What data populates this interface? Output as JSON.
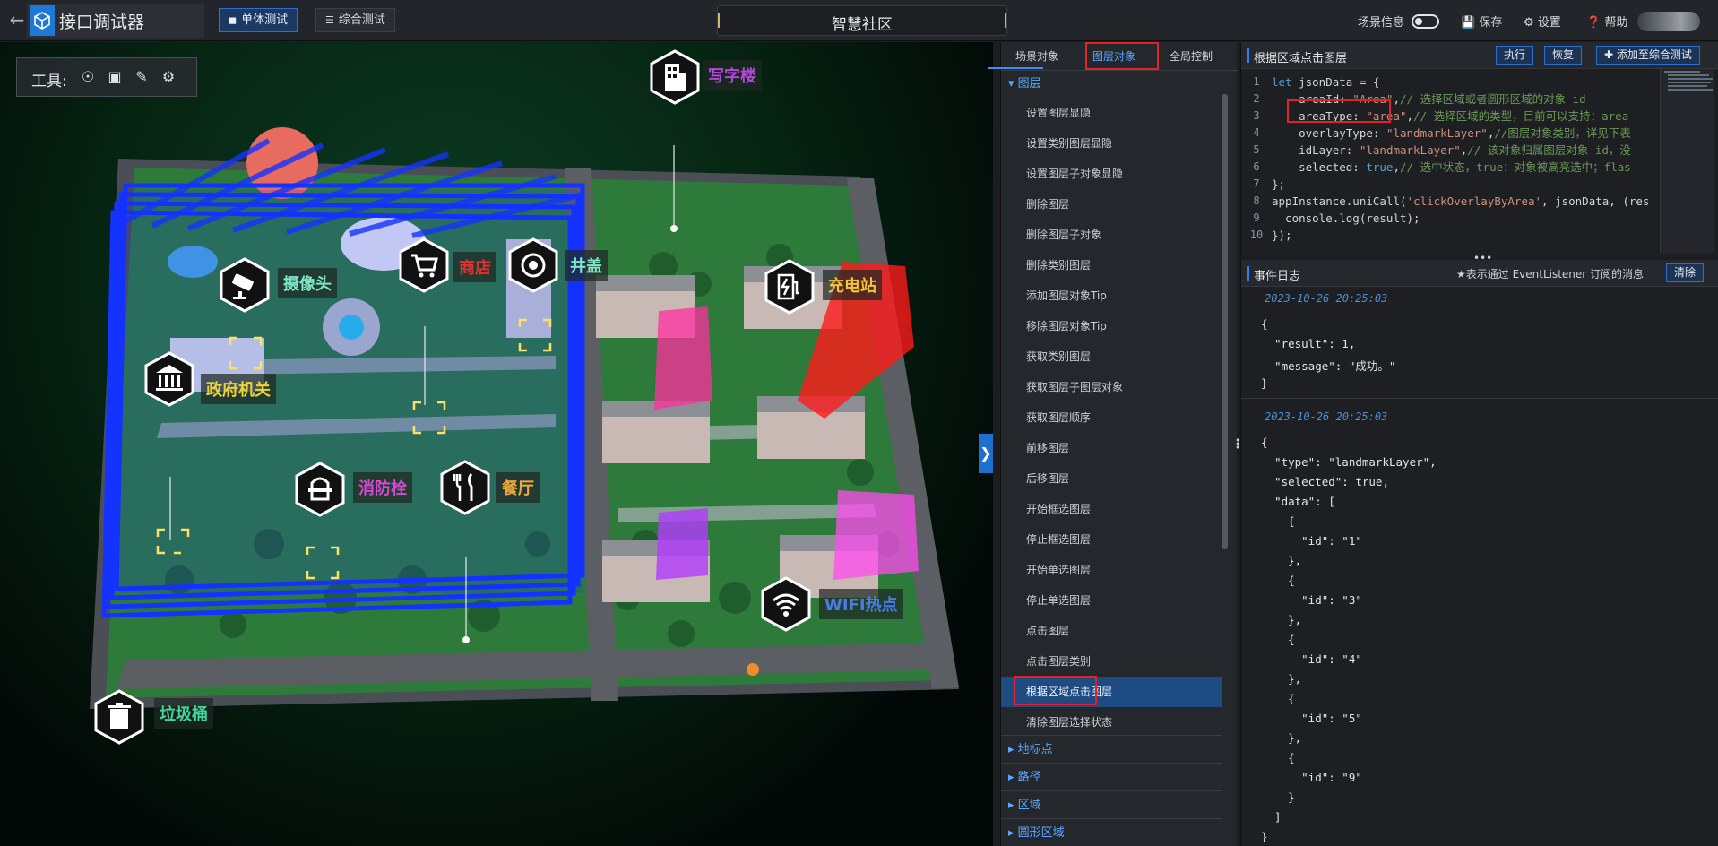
{
  "app": {
    "title": "接口调试器",
    "back_icon": "arrow-left-icon",
    "logo_icon": "cube-logo-icon"
  },
  "modes": [
    {
      "label": "单体测试",
      "active": true,
      "icon": "cube-icon"
    },
    {
      "label": "综合测试",
      "active": false,
      "icon": "layers-icon"
    }
  ],
  "scene": {
    "name": "智慧社区"
  },
  "topbar_right": {
    "scene_info_label": "场景信息",
    "scene_info_on": false,
    "save_label": "保存",
    "settings_label": "设置",
    "help_label": "帮助"
  },
  "toolbar": {
    "label": "工具:",
    "tools": [
      "locate-icon",
      "frame-select-icon",
      "pen-icon",
      "gears-icon"
    ]
  },
  "pois": [
    {
      "label": "写字楼",
      "icon": "office-building-icon",
      "color": "#b048d8"
    },
    {
      "label": "摄像头",
      "icon": "camera-icon",
      "color": "#7fe6c8"
    },
    {
      "label": "商店",
      "icon": "shopping-cart-icon",
      "color": "#e03030"
    },
    {
      "label": "井盖",
      "icon": "manhole-cover-icon",
      "color": "#7fe6c8"
    },
    {
      "label": "充电站",
      "icon": "charging-station-icon",
      "color": "#f2c436"
    },
    {
      "label": "政府机关",
      "icon": "government-icon",
      "color": "#e9d43a"
    },
    {
      "label": "消防栓",
      "icon": "fire-hydrant-icon",
      "color": "#d44ad0"
    },
    {
      "label": "餐厅",
      "icon": "restaurant-icon",
      "color": "#f2a83a"
    },
    {
      "label": "WIFI热点",
      "icon": "wifi-icon",
      "color": "#4a7be8"
    },
    {
      "label": "垃圾桶",
      "icon": "trash-bin-icon",
      "color": "#3ed6a0"
    }
  ],
  "mid_tabs": [
    {
      "label": "场景对象",
      "active": false
    },
    {
      "label": "图层对象",
      "active": true
    },
    {
      "label": "全局控制",
      "active": false
    }
  ],
  "layer_group": {
    "label": "图层",
    "expanded": true,
    "items": [
      "设置图层显隐",
      "设置类别图层显隐",
      "设置图层子对象显隐",
      "删除图层",
      "删除图层子对象",
      "删除类别图层",
      "添加图层对象Tip",
      "移除图层对象Tip",
      "获取类别图层",
      "获取图层子图层对象",
      "获取图层顺序",
      "前移图层",
      "后移图层",
      "开始框选图层",
      "停止框选图层",
      "开始单选图层",
      "停止单选图层",
      "点击图层",
      "点击图层类别",
      "根据区域点击图层",
      "清除图层选择状态"
    ],
    "selected": "根据区域点击图层"
  },
  "other_groups": [
    "地标点",
    "路径",
    "区域",
    "圆形区域"
  ],
  "code_panel": {
    "title": "根据区域点击图层",
    "buttons": {
      "run": "执行",
      "restore": "恢复",
      "add": "添加至综合测试"
    },
    "lines": [
      [
        {
          "t": "let ",
          "c": "#569cd6"
        },
        {
          "t": "jsonData = {",
          "c": "#d4d4d4"
        }
      ],
      [
        {
          "t": "    areaId: ",
          "c": "#d4d4d4"
        },
        {
          "t": "\"Area\"",
          "c": "#ce9178"
        },
        {
          "t": ",",
          "c": "#d4d4d4"
        },
        {
          "t": "// 选择区域或者圆形区域的对象 id",
          "c": "#6a9955"
        }
      ],
      [
        {
          "t": "    areaType: ",
          "c": "#d4d4d4"
        },
        {
          "t": "\"area\"",
          "c": "#ce9178"
        },
        {
          "t": ",",
          "c": "#d4d4d4"
        },
        {
          "t": "// 选择区域的类型，目前可以支持：area",
          "c": "#6a9955"
        }
      ],
      [
        {
          "t": "    overlayType: ",
          "c": "#d4d4d4"
        },
        {
          "t": "\"landmarkLayer\"",
          "c": "#ce9178"
        },
        {
          "t": ",",
          "c": "#d4d4d4"
        },
        {
          "t": "//图层对象类别，详见下表",
          "c": "#6a9955"
        }
      ],
      [
        {
          "t": "    idLayer: ",
          "c": "#d4d4d4"
        },
        {
          "t": "\"landmarkLayer\"",
          "c": "#ce9178"
        },
        {
          "t": ",",
          "c": "#d4d4d4"
        },
        {
          "t": "// 该对象归属图层对象 id，没",
          "c": "#6a9955"
        }
      ],
      [
        {
          "t": "    selected: ",
          "c": "#d4d4d4"
        },
        {
          "t": "true",
          "c": "#569cd6"
        },
        {
          "t": ",",
          "c": "#d4d4d4"
        },
        {
          "t": "// 选中状态，true：对象被高亮选中；flas",
          "c": "#6a9955"
        }
      ],
      [
        {
          "t": "};",
          "c": "#d4d4d4"
        }
      ],
      [
        {
          "t": "appInstance.uniCall(",
          "c": "#d4d4d4"
        },
        {
          "t": "'clickOverlayByArea'",
          "c": "#ce9178"
        },
        {
          "t": ", jsonData, (res",
          "c": "#d4d4d4"
        }
      ],
      [
        {
          "t": "  console.log(result);",
          "c": "#d4d4d4"
        }
      ],
      [
        {
          "t": "});",
          "c": "#d4d4d4"
        }
      ]
    ]
  },
  "event_log": {
    "title": "事件日志",
    "note": "★表示通过 EventListener 订阅的消息",
    "clear_label": "清除",
    "entries": [
      {
        "timestamp": "2023-10-26 20:25:03",
        "lines": [
          "{",
          "  \"result\": 1,",
          "  \"message\": \"成功。\"",
          "}"
        ]
      },
      {
        "timestamp": "2023-10-26 20:25:03",
        "lines": [
          "{",
          "  \"type\": \"landmarkLayer\",",
          "  \"selected\": true,",
          "  \"data\": [",
          "    {",
          "      \"id\": \"1\"",
          "    },",
          "    {",
          "      \"id\": \"3\"",
          "    },",
          "    {",
          "      \"id\": \"4\"",
          "    },",
          "    {",
          "      \"id\": \"5\"",
          "    },",
          "    {",
          "      \"id\": \"9\"",
          "    }",
          "  ]",
          "}"
        ]
      }
    ]
  },
  "colors": {
    "accent": "#2f80ed",
    "highlight_box": "#e2222a",
    "selected_item": "#1d4b82"
  }
}
